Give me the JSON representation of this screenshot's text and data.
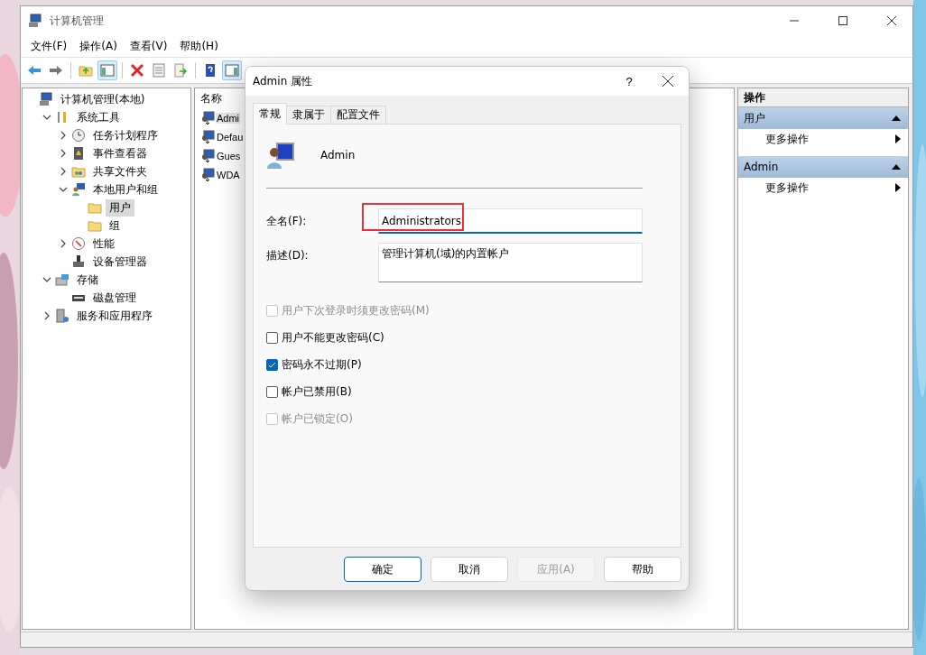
{
  "window": {
    "title": "计算机管理"
  },
  "menu": [
    "文件(F)",
    "操作(A)",
    "查看(V)",
    "帮助(H)"
  ],
  "toolbar": [
    {
      "pressed": false
    },
    {
      "pressed": false
    },
    {
      "pressed": false
    },
    {
      "pressed": true
    },
    {
      "pressed": false
    },
    {
      "pressed": false
    },
    {
      "pressed": false
    },
    {
      "pressed": false
    },
    {
      "pressed": true
    }
  ],
  "tree": [
    {
      "label": "计算机管理(本地)",
      "kind": "leaf",
      "selected": false,
      "children": [
        {
          "label": "系统工具",
          "kind": "group",
          "expanded": true,
          "selected": false,
          "children": [
            {
              "label": "任务计划程序",
              "kind": "group",
              "expanded": false,
              "selected": false
            },
            {
              "label": "事件查看器",
              "kind": "group",
              "expanded": false,
              "selected": false
            },
            {
              "label": "共享文件夹",
              "kind": "group",
              "expanded": false,
              "selected": false
            },
            {
              "label": "本地用户和组",
              "kind": "group",
              "expanded": true,
              "selected": false,
              "children": [
                {
                  "label": "用户",
                  "kind": "leaf",
                  "selected": true
                },
                {
                  "label": "组",
                  "kind": "leaf",
                  "selected": false
                }
              ]
            },
            {
              "label": "性能",
              "kind": "group",
              "expanded": false,
              "selected": false
            },
            {
              "label": "设备管理器",
              "kind": "leaf",
              "selected": false
            }
          ]
        },
        {
          "label": "存储",
          "kind": "group",
          "expanded": true,
          "selected": false,
          "children": [
            {
              "label": "磁盘管理",
              "kind": "leaf",
              "selected": false
            }
          ]
        },
        {
          "label": "服务和应用程序",
          "kind": "group",
          "expanded": false,
          "selected": false
        }
      ]
    }
  ],
  "list": {
    "column": "名称",
    "rows": [
      {
        "name": "Admi",
        "selected": true
      },
      {
        "name": "Defau",
        "selected": false
      },
      {
        "name": "Gues",
        "selected": false
      },
      {
        "name": "WDA",
        "selected": false
      }
    ]
  },
  "actions": {
    "title": "操作",
    "sections": [
      {
        "title": "用户",
        "expanded": true,
        "items": [
          "更多操作"
        ]
      },
      {
        "title": "Admin",
        "expanded": true,
        "items": [
          "更多操作"
        ]
      }
    ]
  },
  "dialog": {
    "title": "Admin 属性",
    "help": "?",
    "tabs": [
      {
        "label": "常规",
        "selected": true
      },
      {
        "label": "隶属于",
        "selected": false
      },
      {
        "label": "配置文件",
        "selected": false
      }
    ],
    "user_name": "Admin",
    "fields": [
      {
        "label": "全名(F):",
        "value": "Administrators",
        "focused": true,
        "highlighted": true,
        "multiline": false
      },
      {
        "label": "描述(D):",
        "value": "管理计算机(域)的内置帐户",
        "focused": false,
        "highlighted": false,
        "multiline": true
      }
    ],
    "checkboxes": [
      {
        "label": "用户下次登录时须更改密码(M)",
        "checked": false,
        "disabled": true
      },
      {
        "label": "用户不能更改密码(C)",
        "checked": false,
        "disabled": false
      },
      {
        "label": "密码永不过期(P)",
        "checked": true,
        "disabled": false
      },
      {
        "label": "帐户已禁用(B)",
        "checked": false,
        "disabled": false
      },
      {
        "label": "帐户已锁定(O)",
        "checked": false,
        "disabled": true
      }
    ],
    "buttons": [
      {
        "label": "确定",
        "default": true,
        "disabled": false
      },
      {
        "label": "取消",
        "default": false,
        "disabled": false
      },
      {
        "label": "应用(A)",
        "default": false,
        "disabled": true
      },
      {
        "label": "帮助",
        "default": false,
        "disabled": false
      }
    ]
  }
}
